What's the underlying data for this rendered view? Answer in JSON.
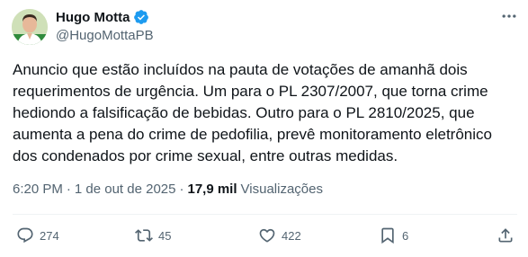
{
  "author": {
    "display_name": "Hugo Motta",
    "handle": "@HugoMottaPB",
    "verified": true
  },
  "post": {
    "text": "Anuncio que estão incluídos na pauta de votações de amanhã dois requerimentos de urgência. Um para o PL 2307/2007, que torna crime hediondo a falsificação de bebidas. Outro para o PL 2810/2025, que aumenta a pena do crime de pedofilia, prevê monitoramento eletrônico dos condenados por crime sexual, entre outras medidas.",
    "time": "6:20 PM",
    "separator": "·",
    "date": "1 de out de 2025",
    "views_count": "17,9 mil",
    "views_label": "Visualizações"
  },
  "actions": {
    "replies": "274",
    "reposts": "45",
    "likes": "422",
    "bookmarks": "6"
  },
  "colors": {
    "text": "#0f1419",
    "secondary": "#536471",
    "verified": "#1d9bf0"
  }
}
